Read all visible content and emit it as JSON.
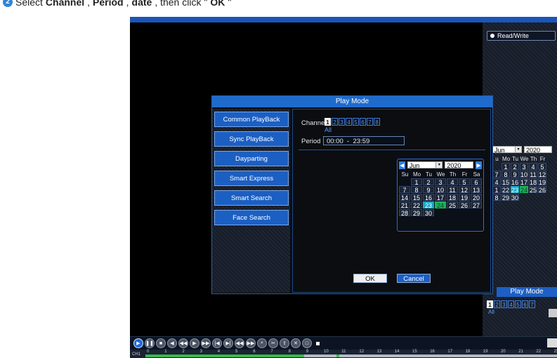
{
  "instruction": {
    "step_number": "2",
    "prefix": "Select",
    "field1": "Channel",
    "sep1": ",",
    "field2": "Period",
    "sep2": ",",
    "field3": "date",
    "middle": ", then click \"",
    "button": "OK",
    "suffix": "\""
  },
  "right_panel": {
    "read_write_label": "Read/Write",
    "calendar": {
      "month": "Jun",
      "year": "2020",
      "weekdays": [
        "u",
        "Mo",
        "Tu",
        "We",
        "Th",
        "Fr",
        ""
      ],
      "weeks": [
        [
          "",
          "1",
          "2",
          "3",
          "4",
          "5",
          ""
        ],
        [
          "7",
          "8",
          "9",
          "10",
          "11",
          "12",
          ""
        ],
        [
          "4",
          "15",
          "16",
          "17",
          "18",
          "19",
          ""
        ],
        [
          "1",
          "22",
          "23",
          "24",
          "25",
          "26",
          ""
        ],
        [
          "8",
          "29",
          "30",
          "",
          "",
          "",
          ""
        ]
      ]
    },
    "play_mode_label": "Play Mode",
    "channels": [
      "1",
      "2",
      "3",
      "4",
      "5",
      "6",
      "7"
    ],
    "all_label": "All"
  },
  "dialog": {
    "title": "Play Mode",
    "modes": [
      "Common PlayBack",
      "Sync PlayBack",
      "Dayparting",
      "Smart Express",
      "Smart Search",
      "Face Search"
    ],
    "channel_label": "Channel",
    "channels": [
      "1",
      "2",
      "3",
      "4",
      "5",
      "6",
      "7",
      "8"
    ],
    "all_label": "All",
    "period_label": "Period",
    "period_value": "00:00  -  23:59",
    "calendar": {
      "month": "Jun",
      "year": "2020",
      "weekdays": [
        "Su",
        "Mo",
        "Tu",
        "We",
        "Th",
        "Fr",
        "Sa"
      ],
      "weeks": [
        [
          "",
          "1",
          "2",
          "3",
          "4",
          "5",
          "6"
        ],
        [
          "7",
          "8",
          "9",
          "10",
          "11",
          "12",
          "13"
        ],
        [
          "14",
          "15",
          "16",
          "17",
          "18",
          "19",
          "20"
        ],
        [
          "21",
          "22",
          "23",
          "24",
          "25",
          "26",
          "27"
        ],
        [
          "28",
          "29",
          "30",
          "",
          "",
          "",
          ""
        ]
      ],
      "selected_day": "23",
      "record_day": "24"
    },
    "ok_label": "OK",
    "cancel_label": "Cancel"
  },
  "timeline": {
    "channel_label": "CH1",
    "hours": [
      "0",
      "1",
      "2",
      "3",
      "4",
      "5",
      "6",
      "7",
      "8",
      "9",
      "10",
      "11",
      "12",
      "13",
      "14",
      "15",
      "16",
      "17",
      "18",
      "19",
      "20",
      "21",
      "22",
      "23"
    ]
  },
  "colors": {
    "accent_blue": "#1f6bcc",
    "record_green": "#3cb84a",
    "selected_cyan": "#19a8c4"
  }
}
